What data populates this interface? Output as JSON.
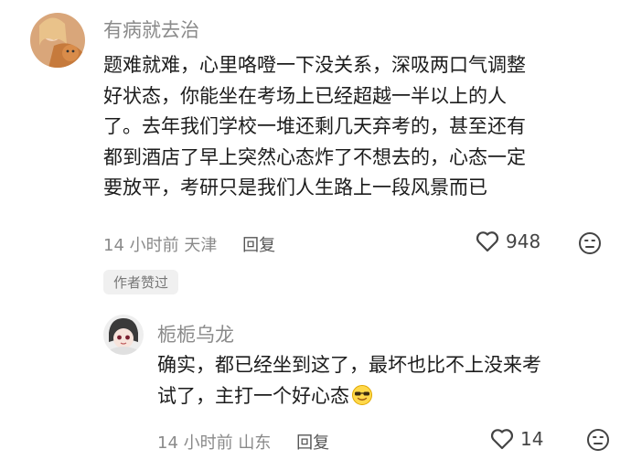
{
  "comment": {
    "username": "有病就去治",
    "lines": [
      "题难就难，心里咯噔一下没关系，深吸两口气调整",
      "好状态，你能坐在考场上已经超越一半以上的人",
      "了。去年我们学校一堆还剩几天弃考的，甚至还有",
      "都到酒店了早上突然心态炸了不想去的，心态一定",
      "要放平，考研只是我们人生路上一段风景而已"
    ],
    "time": "14 小时前",
    "location": "天津",
    "reply_label": "回复",
    "likes": "948",
    "badge": "作者赞过"
  },
  "reply": {
    "username": "栀栀乌龙",
    "lines": [
      "确实，都已经坐到这了，最坏也比不上没来考",
      "试了，主打一个好心态"
    ],
    "time": "14 小时前",
    "location": "山东",
    "reply_label": "回复",
    "likes": "14"
  },
  "icons": {
    "like": "heart-outline-icon",
    "dislike": "unhappy-face-icon",
    "emoji": "smile-sunglasses-emoji"
  }
}
